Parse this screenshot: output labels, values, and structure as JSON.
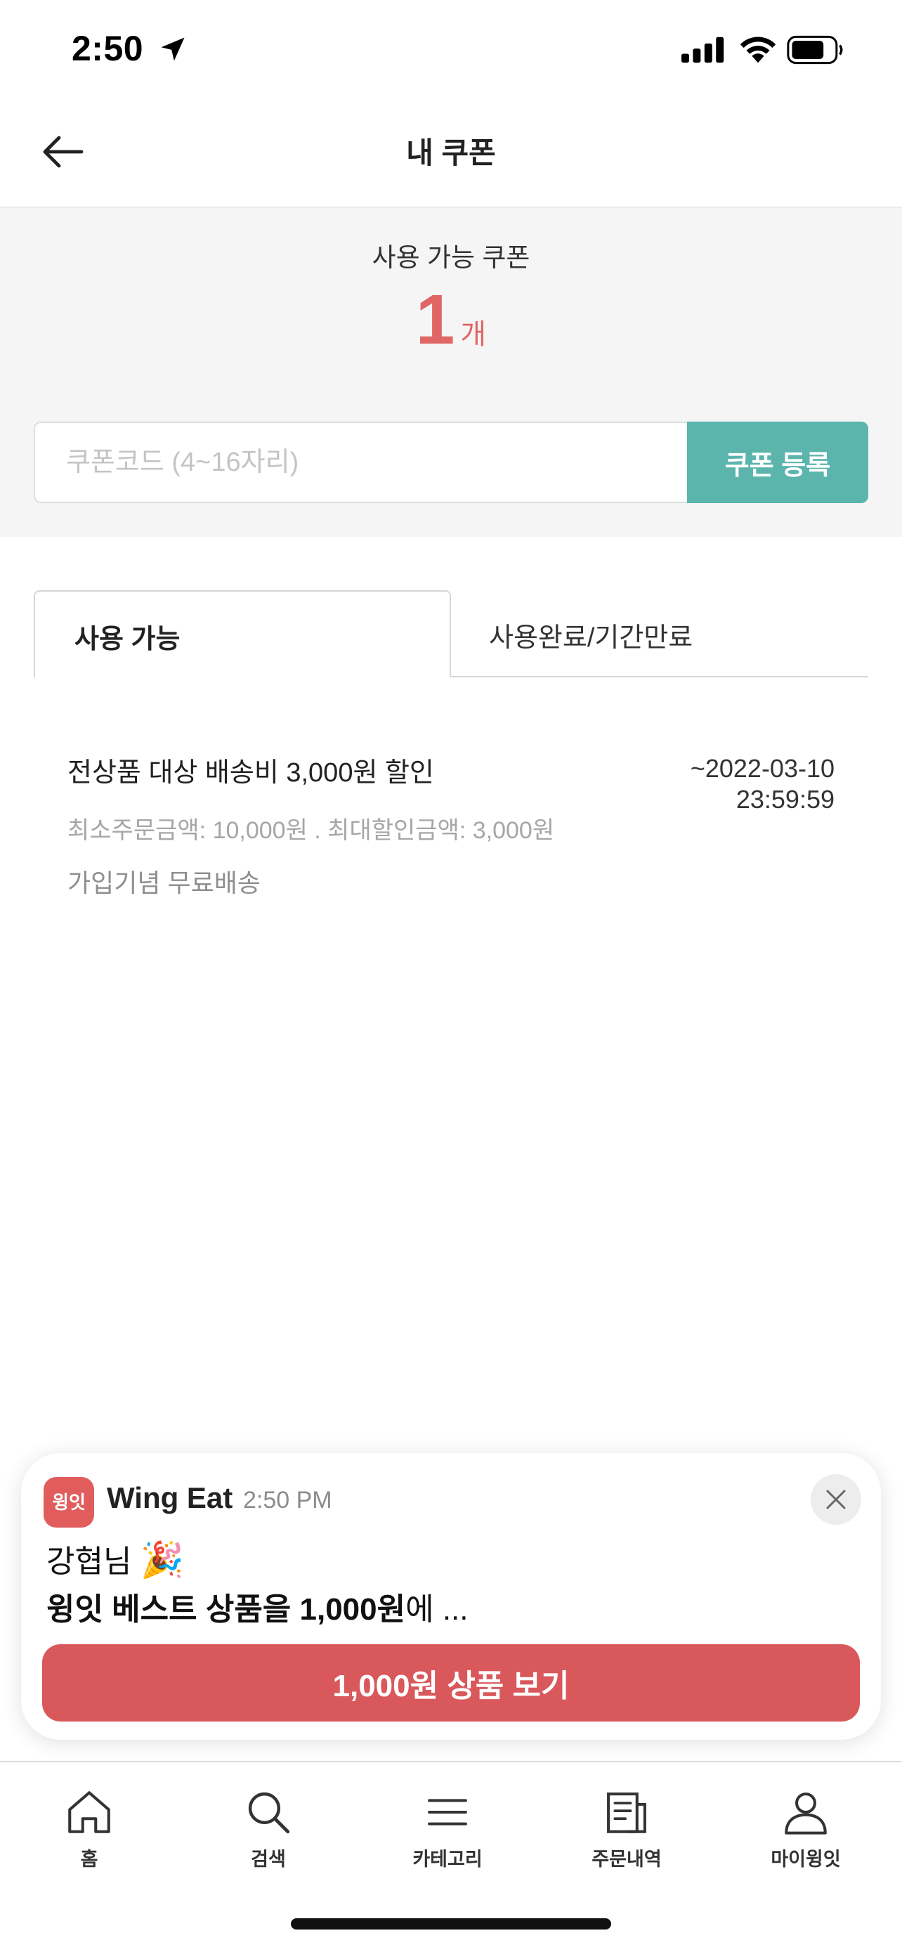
{
  "status_bar": {
    "time": "2:50"
  },
  "header": {
    "title": "내 쿠폰"
  },
  "summary": {
    "label": "사용 가능 쿠폰",
    "count": "1",
    "unit": "개",
    "accent_color": "#e06666"
  },
  "coupon_register": {
    "placeholder": "쿠폰코드 (4~16자리)",
    "value": "",
    "button_label": "쿠폰 등록",
    "button_color": "#5bb5ad"
  },
  "tabs": [
    {
      "label": "사용 가능",
      "active": true
    },
    {
      "label": "사용완료/기간만료",
      "active": false
    }
  ],
  "coupons": [
    {
      "title": "전상품 대상 배송비 3,000원 할인",
      "expiry_date": "~2022-03-10",
      "expiry_time": "23:59:59",
      "conditions": "최소주문금액: 10,000원 . 최대할인금액: 3,000원",
      "description": "가입기념 무료배송"
    }
  ],
  "notification": {
    "app_icon_text": "윙잇",
    "app_name": "Wing Eat",
    "time": "2:50 PM",
    "line1": "강협님",
    "line1_emoji": "🎉",
    "line2_bold": "윙잇 베스트 상품을 1,000원",
    "line2_rest": "에 ...",
    "cta_label": "1,000원 상품 보기",
    "cta_color": "#d9585c"
  },
  "bottom_nav": [
    {
      "label": "홈",
      "icon": "home-icon"
    },
    {
      "label": "검색",
      "icon": "search-icon"
    },
    {
      "label": "카테고리",
      "icon": "menu-icon"
    },
    {
      "label": "주문내역",
      "icon": "order-list-icon"
    },
    {
      "label": "마이윙잇",
      "icon": "profile-icon"
    }
  ]
}
